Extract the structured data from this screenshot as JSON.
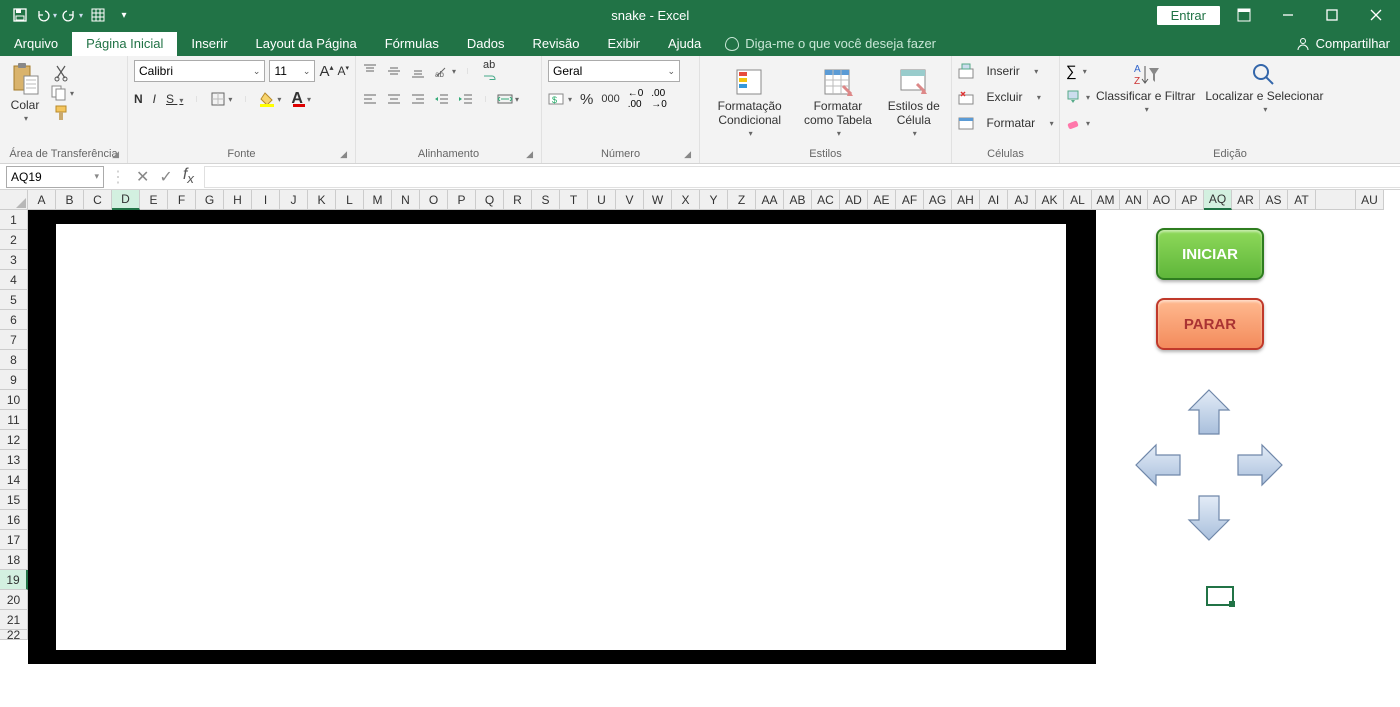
{
  "title": "snake  -  Excel",
  "signin": "Entrar",
  "tabs": {
    "file": "Arquivo",
    "home": "Página Inicial",
    "insert": "Inserir",
    "layout": "Layout da Página",
    "formulas": "Fórmulas",
    "data": "Dados",
    "review": "Revisão",
    "view": "Exibir",
    "help": "Ajuda",
    "tellme": "Diga-me o que você deseja fazer",
    "share": "Compartilhar"
  },
  "ribbon": {
    "clipboard": {
      "paste": "Colar",
      "label": "Área de Transferência"
    },
    "font": {
      "name": "Calibri",
      "size": "11",
      "bold": "N",
      "italic": "I",
      "underline": "S",
      "label": "Fonte"
    },
    "alignment": {
      "wrap": "ab",
      "label": "Alinhamento"
    },
    "number": {
      "format": "Geral",
      "pct": "%",
      "sep": "000",
      "label": "Número"
    },
    "styles": {
      "cond": "Formatação Condicional",
      "table": "Formatar como Tabela",
      "cell": "Estilos de Célula",
      "label": "Estilos"
    },
    "cells": {
      "insert": "Inserir",
      "delete": "Excluir",
      "format": "Formatar",
      "label": "Células"
    },
    "editing": {
      "sort": "Classificar e Filtrar",
      "find": "Localizar e Selecionar",
      "label": "Edição"
    }
  },
  "namebox": "AQ19",
  "columns": [
    "A",
    "B",
    "C",
    "D",
    "E",
    "F",
    "G",
    "H",
    "I",
    "J",
    "K",
    "L",
    "M",
    "N",
    "O",
    "P",
    "Q",
    "R",
    "S",
    "T",
    "U",
    "V",
    "W",
    "X",
    "Y",
    "Z",
    "AA",
    "AB",
    "AC",
    "AD",
    "AE",
    "AF",
    "AG",
    "AH",
    "AI",
    "AJ",
    "AK",
    "AL",
    "AM",
    "AN",
    "AO",
    "AP",
    "AQ",
    "AR",
    "AS",
    "AT",
    "",
    "AU"
  ],
  "selected_col_index": 42,
  "highlight_col_index": 3,
  "rows": 22,
  "selected_row": 19,
  "game": {
    "start": "INICIAR",
    "stop": "PARAR"
  }
}
